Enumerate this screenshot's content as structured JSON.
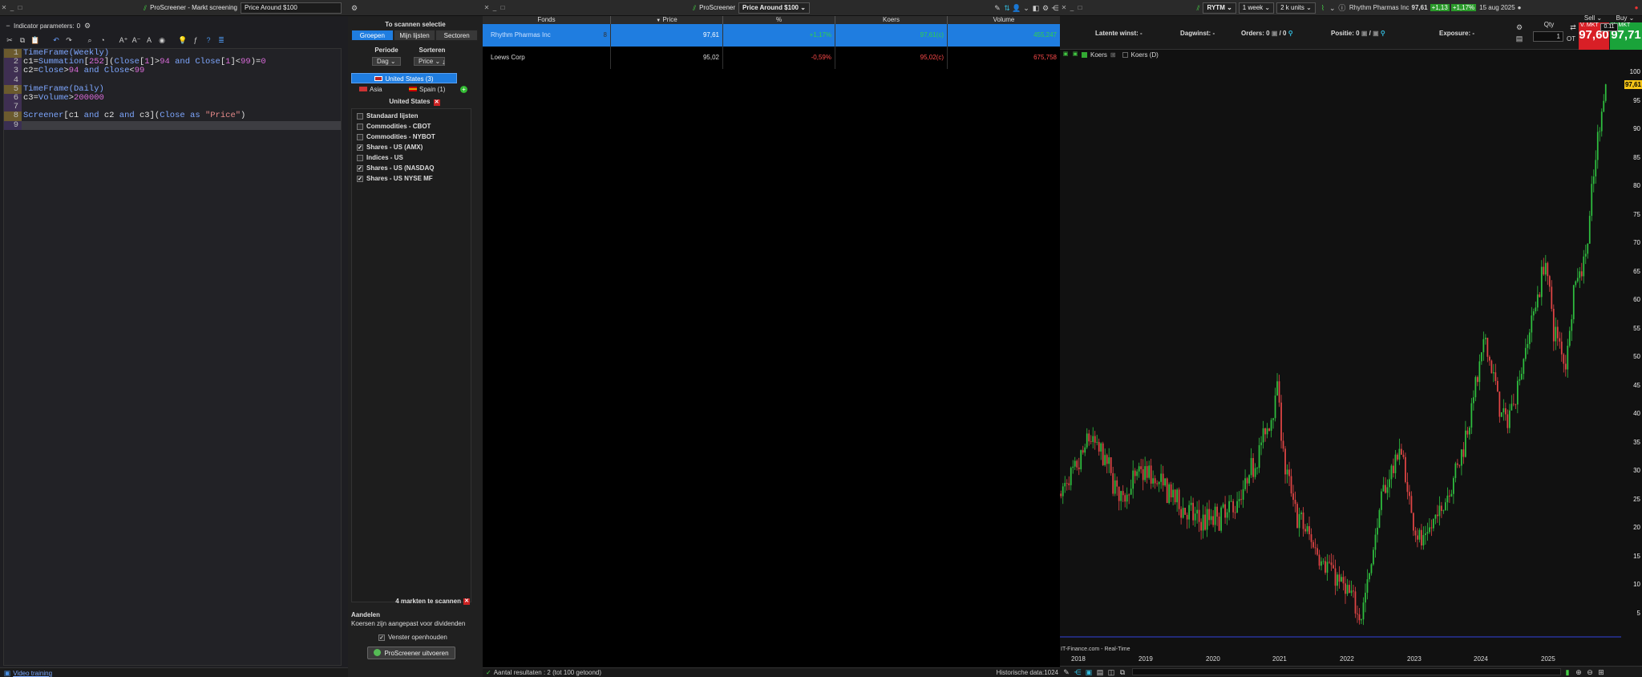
{
  "editor": {
    "title": "ProScreener - Markt screening",
    "name": "Price Around $100",
    "params_label": "Indicator parameters:",
    "params_count": "0",
    "link": "Video training",
    "lines": [
      {
        "n": "1",
        "t": [
          [
            "TimeFrame(Weekly)",
            "kw"
          ]
        ]
      },
      {
        "n": "2",
        "t": [
          [
            "c1",
            "op"
          ],
          [
            "=",
            "op"
          ],
          [
            "Summation",
            "kw"
          ],
          [
            "[",
            "op"
          ],
          [
            "252",
            "nm"
          ],
          [
            "](",
            "op"
          ],
          [
            "Close",
            "kw"
          ],
          [
            "[",
            "op"
          ],
          [
            "1",
            "nm"
          ],
          [
            "]>",
            "op"
          ],
          [
            "94",
            "nm"
          ],
          [
            " and ",
            "kw"
          ],
          [
            "Close",
            "kw"
          ],
          [
            "[",
            "op"
          ],
          [
            "1",
            "nm"
          ],
          [
            "]<",
            "op"
          ],
          [
            "99",
            "nm"
          ],
          [
            ")=",
            "op"
          ],
          [
            "0",
            "nm"
          ]
        ]
      },
      {
        "n": "3",
        "t": [
          [
            "c2",
            "op"
          ],
          [
            "=",
            "op"
          ],
          [
            "Close",
            "kw"
          ],
          [
            ">",
            "op"
          ],
          [
            "94",
            "nm"
          ],
          [
            " and ",
            "kw"
          ],
          [
            "Close",
            "kw"
          ],
          [
            "<",
            "op"
          ],
          [
            "99",
            "nm"
          ]
        ]
      },
      {
        "n": "4",
        "t": []
      },
      {
        "n": "5",
        "t": [
          [
            "TimeFrame(Daily)",
            "kw"
          ]
        ]
      },
      {
        "n": "6",
        "t": [
          [
            "c3",
            "op"
          ],
          [
            "=",
            "op"
          ],
          [
            "Volume",
            "kw"
          ],
          [
            ">",
            "op"
          ],
          [
            "200000",
            "nm"
          ]
        ]
      },
      {
        "n": "7",
        "t": []
      },
      {
        "n": "8",
        "t": [
          [
            "Screener",
            "kw"
          ],
          [
            "[",
            "op"
          ],
          [
            "c1",
            "op"
          ],
          [
            " and ",
            "kw"
          ],
          [
            "c2",
            "op"
          ],
          [
            " and ",
            "kw"
          ],
          [
            "c3",
            "op"
          ],
          [
            "](",
            "op"
          ],
          [
            "Close",
            "kw"
          ],
          [
            " as ",
            "kw"
          ],
          [
            "\"Price\"",
            "st"
          ],
          [
            ")",
            "op"
          ]
        ]
      },
      {
        "n": "9",
        "t": []
      }
    ]
  },
  "scan": {
    "title": "To scannen selectie",
    "tabs": [
      "Groepen",
      "Mijn lijsten",
      "Sectoren"
    ],
    "periode_label": "Periode",
    "periode_value": "Dag",
    "sorteren_label": "Sorteren",
    "sorteren_value": "Price",
    "region_us": "United States (3)",
    "region_asia": "Asia",
    "region_spain": "Spain (1)",
    "selected_group": "United States",
    "lists": [
      {
        "label": "Standaard lijsten",
        "checked": false
      },
      {
        "label": "Commodities - CBOT",
        "checked": false
      },
      {
        "label": "Commodities - NYBOT",
        "checked": false
      },
      {
        "label": "Shares - US (AMX)",
        "checked": true
      },
      {
        "label": "Indices - US",
        "checked": false
      },
      {
        "label": "Shares - US (NASDAQ",
        "checked": true
      },
      {
        "label": "Shares - US NYSE MF",
        "checked": true
      }
    ],
    "markets_count": "4 markten te scannen",
    "aandelen_title": "Aandelen",
    "aandelen_note": "Koersen zijn aangepast voor dividenden",
    "keep_open": "Venster openhouden",
    "run_button": "ProScreener uitvoeren"
  },
  "list": {
    "app": "ProScreener",
    "name": "Price Around $100",
    "columns": [
      "Fonds",
      "Price",
      "%",
      "Koers",
      "Volume"
    ],
    "sort_arrow": "▼",
    "rows": [
      {
        "fonds": "Rhythm Pharmas Inc",
        "mark": "8",
        "price": "97,61",
        "pct": "+1,17%",
        "koers": "97,61(c)",
        "volume": "455,247",
        "pos": true
      },
      {
        "fonds": "Loews Corp",
        "mark": "",
        "price": "95,02",
        "pct": "-0,59%",
        "koers": "95,02(c)",
        "volume": "675,758",
        "pos": false
      }
    ],
    "status": "Aantal resultaten : 2 (tot 100 getoond)",
    "hist": "Historische data:1024"
  },
  "chart": {
    "ticker": "RYTM",
    "period": "1 week",
    "units": "2 k units",
    "name": "Rhythm Pharmas Inc",
    "last": "97,61",
    "chg": "+1,13",
    "pct": "+1,17%",
    "date": "15 aug 2025",
    "latent": "Latente winst: -",
    "dag": "Dagwinst: -",
    "orders": "Orders: 0",
    "orders2": "/ 0",
    "positie": "Positie: 0",
    "exposure": "Exposure: -",
    "qty_label": "Qty",
    "qty": "1",
    "sell": "Sell",
    "buy": "Buy",
    "sell_mkt": "V. MKT",
    "buy_mkt": "K. MKT",
    "spread": "0.11",
    "sell_price": "97,60",
    "buy_price": "97,71",
    "ot": "OT",
    "legend1": "Koers",
    "legend2": "Koers (D)",
    "price_tag": "97,61",
    "source": "IT-Finance.com - Real-Time",
    "y_ticks": [
      "100",
      "95",
      "90",
      "85",
      "80",
      "75",
      "70",
      "65",
      "60",
      "55",
      "50",
      "45",
      "40",
      "35",
      "30",
      "25",
      "20",
      "15",
      "10",
      "5"
    ],
    "x_ticks": [
      "2018",
      "2019",
      "2020",
      "2021",
      "2022",
      "2023",
      "2024",
      "2025"
    ]
  },
  "chart_data": {
    "type": "candlestick",
    "title": "Rhythm Pharmas Inc",
    "ylim": [
      0,
      102
    ],
    "x": [
      "2018",
      "2019",
      "2020",
      "2021",
      "2022",
      "2023",
      "2024",
      "2025"
    ],
    "anchors": [
      [
        0,
        26
      ],
      [
        8,
        30
      ],
      [
        14,
        36
      ],
      [
        22,
        32
      ],
      [
        30,
        25
      ],
      [
        40,
        30
      ],
      [
        52,
        27
      ],
      [
        62,
        23
      ],
      [
        70,
        21
      ],
      [
        80,
        22
      ],
      [
        90,
        25
      ],
      [
        98,
        33
      ],
      [
        104,
        38
      ],
      [
        108,
        45
      ],
      [
        112,
        30
      ],
      [
        118,
        22
      ],
      [
        128,
        16
      ],
      [
        138,
        11
      ],
      [
        146,
        7
      ],
      [
        150,
        5
      ],
      [
        154,
        12
      ],
      [
        160,
        25
      ],
      [
        166,
        31
      ],
      [
        170,
        34
      ],
      [
        174,
        24
      ],
      [
        180,
        17
      ],
      [
        188,
        22
      ],
      [
        194,
        27
      ],
      [
        200,
        33
      ],
      [
        206,
        43
      ],
      [
        212,
        53
      ],
      [
        218,
        43
      ],
      [
        222,
        38
      ],
      [
        228,
        45
      ],
      [
        236,
        58
      ],
      [
        242,
        67
      ],
      [
        246,
        55
      ],
      [
        252,
        49
      ],
      [
        256,
        62
      ],
      [
        262,
        68
      ],
      [
        268,
        88
      ],
      [
        272,
        99
      ]
    ]
  }
}
